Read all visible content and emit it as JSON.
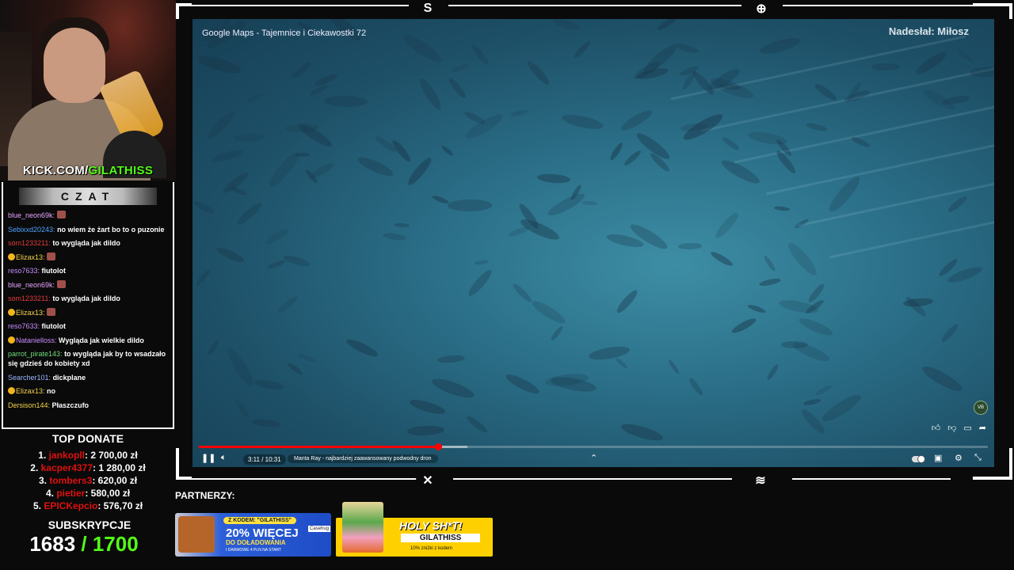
{
  "webcam": {
    "kick_prefix": "KICK.COM/",
    "kick_channel": "GILATHISS"
  },
  "chat": {
    "title": "CZAT",
    "messages": [
      {
        "user": "blue_neon69k:",
        "color": "#e8a3ff",
        "text": "",
        "emote": true,
        "badge": false
      },
      {
        "user": "Sebixxd20243:",
        "color": "#4ea3ff",
        "text": "no wiem że żart bo to o puzonie",
        "emote": false,
        "badge": false
      },
      {
        "user": "som1233211:",
        "color": "#e23b3b",
        "text": "to wygląda jak dildo",
        "emote": false,
        "badge": false
      },
      {
        "user": "Elizax13:",
        "color": "#f3d34a",
        "text": "",
        "emote": true,
        "badge": true
      },
      {
        "user": "reso7633:",
        "color": "#c98cff",
        "text": "fiutolot",
        "emote": false,
        "badge": false
      },
      {
        "user": "blue_neon69k:",
        "color": "#e8a3ff",
        "text": "",
        "emote": true,
        "badge": false
      },
      {
        "user": "som1233211:",
        "color": "#e23b3b",
        "text": "to wygląda jak dildo",
        "emote": false,
        "badge": false
      },
      {
        "user": "Elizax13:",
        "color": "#f3d34a",
        "text": "",
        "emote": true,
        "badge": true
      },
      {
        "user": "reso7633:",
        "color": "#c98cff",
        "text": "fiutolot",
        "emote": false,
        "badge": false
      },
      {
        "user": "Natanielloss:",
        "color": "#c98cff",
        "text": "Wygląda jak wielkie dildo",
        "emote": false,
        "badge": true
      },
      {
        "user": "parrot_pirate143:",
        "color": "#6fdc7a",
        "text": "to wygląda jak by to wsadzało się gdzieś do kobiety xd",
        "emote": false,
        "badge": false
      },
      {
        "user": "Searcher101:",
        "color": "#9bb7ff",
        "text": "dickplane",
        "emote": false,
        "badge": false
      },
      {
        "user": "Elizax13:",
        "color": "#f3d34a",
        "text": "no",
        "emote": false,
        "badge": true
      },
      {
        "user": "Dersison144:",
        "color": "#f3d34a",
        "text": "Płaszczufo",
        "emote": false,
        "badge": false
      }
    ]
  },
  "donate": {
    "title": "TOP DONATE",
    "items": [
      {
        "rank": "1.",
        "name": "jankopll",
        "amount": ": 2 700,00 zł"
      },
      {
        "rank": "2.",
        "name": "kacper4377",
        "amount": ": 1 280,00 zł"
      },
      {
        "rank": "3.",
        "name": "tombers3",
        "amount": ": 620,00 zł"
      },
      {
        "rank": "4.",
        "name": "pietier",
        "amount": ": 580,00 zł"
      },
      {
        "rank": "5.",
        "name": "EPICKepcio",
        "amount": ": 576,70 zł"
      }
    ]
  },
  "subs": {
    "title": "SUBSKRYPCJE",
    "current": "1683",
    "goal": " / 1700"
  },
  "video": {
    "title": "Google Maps - Tajemnice i Ciekawostki 72",
    "sender": "Nadesłał: Miłosz",
    "time": "3:11 / 10:31",
    "chapter": "Manta Ray - najbardziej zaawansowany podwodny dron",
    "progress": 0.303,
    "channel_logo": "VB"
  },
  "partners": {
    "label": "PARTNERZY:",
    "sponsor1": {
      "code": "Z KODEM: \"GILATHISS\"",
      "percent": "20% WIĘCEJ",
      "line1": "DO DOŁADOWANIA",
      "line2": "I DARMOWE 4 PLN NA START",
      "brand": "Casehug"
    },
    "sponsor2": {
      "headline": "HOLY SH*T!",
      "code": "GILATHISS",
      "promo": "10% zniżki z kodem"
    }
  }
}
